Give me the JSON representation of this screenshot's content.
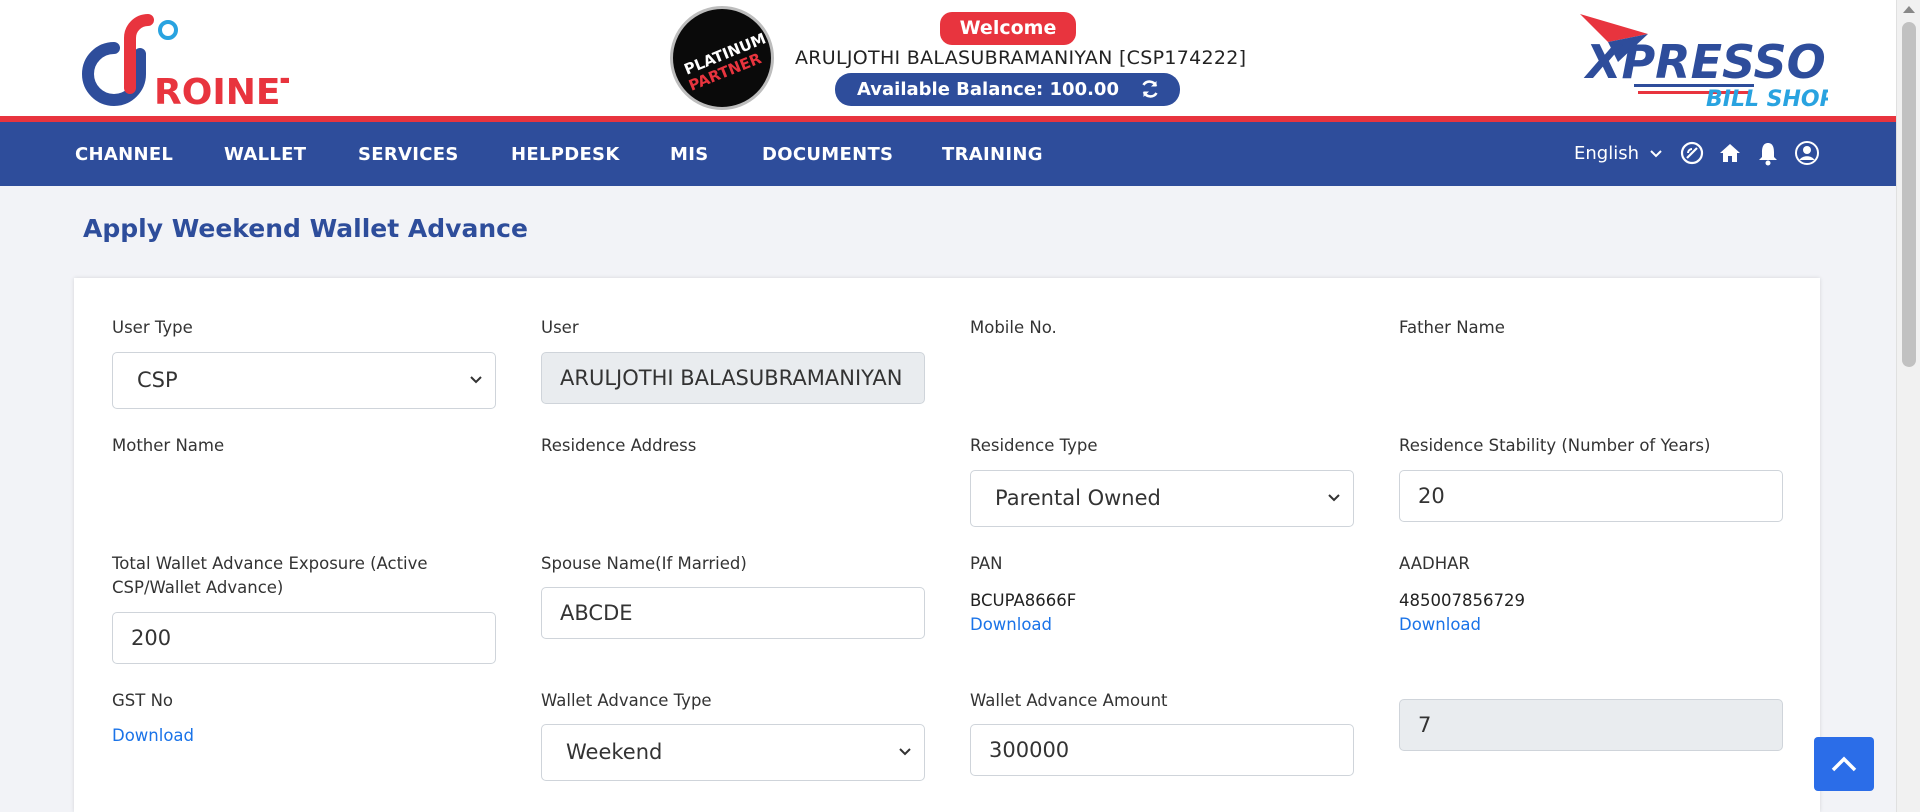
{
  "header": {
    "brand_left": "ROINET",
    "partner_line1": "PLATINUM",
    "partner_line2": "PARTNER",
    "welcome": "Welcome",
    "user_display": "ARULJOTHI BALASUBRAMANIYAN [CSP174222]",
    "balance_text": "Available Balance: 100.00",
    "brand_right_line1": "XPRESSO",
    "brand_right_line2": "BILL SHOP"
  },
  "nav": {
    "items": [
      "CHANNEL",
      "WALLET",
      "SERVICES",
      "HELPDESK",
      "MIS",
      "DOCUMENTS",
      "TRAINING"
    ],
    "language": "English",
    "icons": [
      "dashboard-icon",
      "home-icon",
      "bell-icon",
      "user-icon"
    ]
  },
  "page": {
    "title": "Apply Weekend Wallet Advance"
  },
  "form": {
    "user_type": {
      "label": "User Type",
      "value": "CSP"
    },
    "user": {
      "label": "User",
      "value": "ARULJOTHI BALASUBRAMANIYAN"
    },
    "mobile": {
      "label": "Mobile No."
    },
    "father_name": {
      "label": "Father Name"
    },
    "mother_name": {
      "label": "Mother Name"
    },
    "residence_address": {
      "label": "Residence Address"
    },
    "residence_type": {
      "label": "Residence Type",
      "value": "Parental Owned"
    },
    "residence_stability": {
      "label": "Residence Stability (Number of Years)",
      "value": "20"
    },
    "total_exposure": {
      "label_line1": "Total Wallet Advance Exposure (Active",
      "label_line2": "CSP/Wallet Advance)",
      "value": "200"
    },
    "spouse_name": {
      "label": "Spouse Name(If Married)",
      "value": "ABCDE"
    },
    "pan": {
      "label": "PAN",
      "value": "BCUPA8666F",
      "link": "Download"
    },
    "aadhar": {
      "label": "AADHAR",
      "value": "485007856729",
      "link": "Download"
    },
    "gst": {
      "label": "GST No",
      "link": "Download"
    },
    "advance_type": {
      "label": "Wallet Advance Type",
      "value": "Weekend"
    },
    "advance_amount": {
      "label": "Wallet Advance Amount",
      "value": "300000"
    },
    "days": {
      "value": "7"
    }
  },
  "colors": {
    "primary": "#2e4d9b",
    "accent_red": "#e8343e",
    "link": "#1a73e8"
  }
}
